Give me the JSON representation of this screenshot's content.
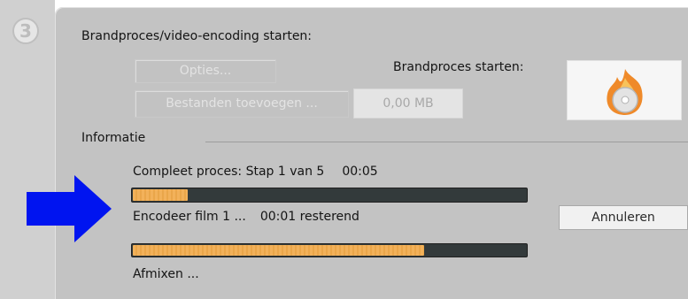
{
  "step": {
    "number": "3"
  },
  "burn": {
    "heading": "Brandproces/video-encoding starten:",
    "options_label": "Opties...",
    "add_files_label": "Bestanden toevoegen ...",
    "size_value": "0,00 MB",
    "start_label": "Brandproces starten:",
    "start_icon": "burn-flame-disc-icon"
  },
  "info": {
    "heading": "Informatie",
    "overall": {
      "label": "Compleet proces: Stap 1 van 5",
      "time": "00:05",
      "progress": 0.14
    },
    "encode": {
      "label": "Encodeer film 1 ...",
      "remaining": "00:01 resterend",
      "progress": 0.74
    },
    "cancel_label": "Annuleren",
    "next_label": "Afmixen ..."
  },
  "annotation": {
    "icon": "blue-arrow-icon"
  },
  "colors": {
    "panel": "#c3c3c3",
    "progress_fill": "#f2b15a",
    "progress_track": "#333a3b",
    "arrow": "#0014f0"
  }
}
